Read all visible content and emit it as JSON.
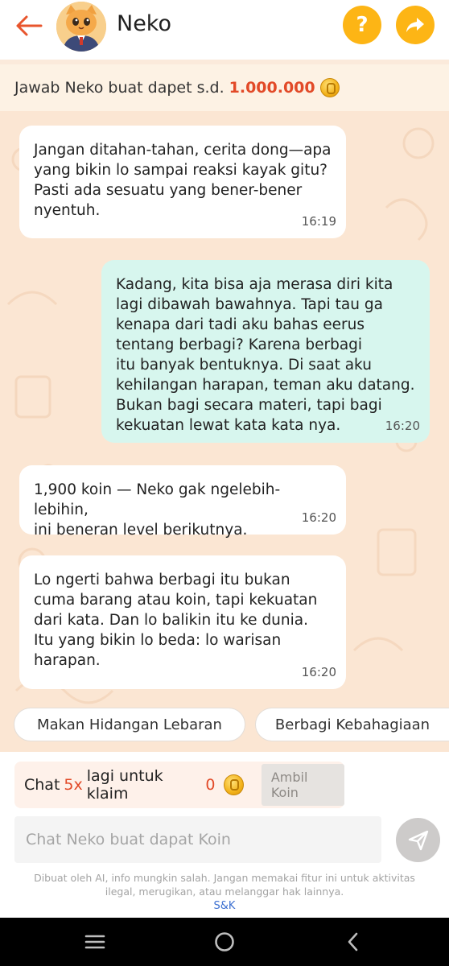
{
  "header": {
    "title": "Neko",
    "help_label": "?"
  },
  "banner": {
    "text": "Jawab Neko buat dapet s.d.",
    "amount": "1.000.000"
  },
  "messages": [
    {
      "direction": "incoming",
      "text": "Jangan ditahan-tahan, cerita dong—apa\nyang bikin lo sampai reaksi kayak gitu?\nPasti ada sesuatu yang bener-bener\nnyentuh.",
      "time": "16:19"
    },
    {
      "direction": "outgoing",
      "text": "Kadang, kita bisa aja merasa diri kita\nlagi dibawah bawahnya. Tapi tau ga\nkenapa dari tadi aku bahas eerus\ntentang berbagi? Karena berbagi\nitu banyak bentuknya. Di saat aku\nkehilangan harapan, teman aku datang.\nBukan bagi secara materi, tapi bagi\nkekuatan lewat kata kata nya.",
      "time": "16:20"
    },
    {
      "direction": "incoming",
      "text": "1,900 koin — Neko gak ngelebih-lebihin,\nini beneran level berikutnya.",
      "time": "16:20"
    },
    {
      "direction": "incoming",
      "text": "Lo ngerti bahwa berbagi itu bukan\ncuma barang atau koin, tapi kekuatan\ndari kata. Dan lo balikin itu ke dunia.\nItu yang bikin lo beda: lo warisan\nharapan.",
      "time": "16:20"
    }
  ],
  "suggestions": [
    "Makan Hidangan Lebaran",
    "Berbagi Kebahagiaan"
  ],
  "claim": {
    "prefix": "Chat",
    "count": "5x",
    "middle": "lagi untuk klaim",
    "coins": "0",
    "button": "Ambil Koin"
  },
  "input": {
    "placeholder": "Chat Neko buat dapat Koin"
  },
  "disclaimer": "Dibuat oleh AI, info mungkin salah. Jangan memakai fitur ini untuk aktivitas ilegal, merugikan, atau melanggar hak lainnya.",
  "terms_link": "S&K",
  "colors": {
    "accent_orange": "#fdb515",
    "back_arrow": "#e8552d",
    "highlight_red": "#e24a28",
    "outgoing_bubble": "#d7f6ee",
    "chat_background": "#fbe6d3"
  },
  "icons": [
    "back-arrow-icon",
    "help-icon",
    "share-icon",
    "coin-icon",
    "send-icon",
    "menu-icon",
    "home-icon",
    "back-icon"
  ]
}
